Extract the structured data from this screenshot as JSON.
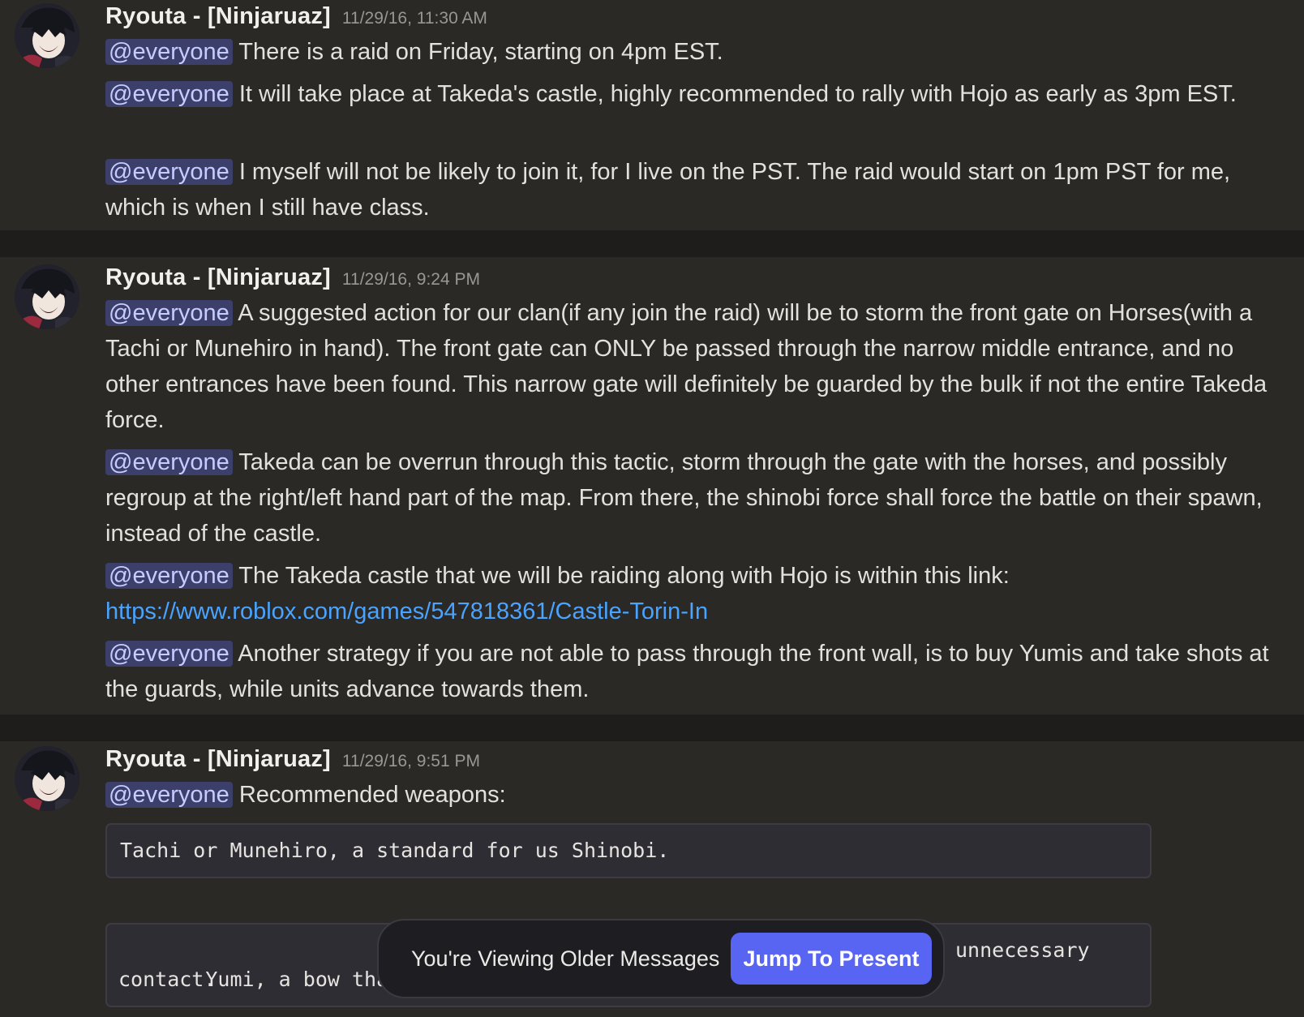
{
  "messages": [
    {
      "author": "Ryouta - [Ninjaruaz]",
      "timestamp": "11/29/16, 11:30 AM",
      "paragraphs": [
        {
          "mention": "@everyone",
          "text": "There is a raid on Friday, starting on 4pm EST."
        },
        {
          "mention": "@everyone",
          "text": "It will take place at Takeda's castle, highly recommended to rally with Hojo as early as 3pm EST."
        },
        {
          "mention": "@everyone",
          "text": "I myself will not be likely to join it, for I live on the PST. The raid would start on 1pm PST for me, which is when I still have class."
        }
      ]
    },
    {
      "author": "Ryouta - [Ninjaruaz]",
      "timestamp": "11/29/16, 9:24 PM",
      "paragraphs": [
        {
          "mention": "@everyone",
          "text": "A suggested action for our clan(if any join the raid) will be to storm the front gate on Horses(with a Tachi or Munehiro in hand). The front gate can ONLY be passed through the narrow middle entrance, and no other entrances have been found. This narrow gate will definitely be guarded by the bulk if not the entire Takeda force."
        },
        {
          "mention": "@everyone",
          "text": "Takeda can be overrun through this tactic, storm through the gate with the horses, and possibly regroup at the right/left hand part of the map. From there, the shinobi force shall force the battle on their spawn, instead of the castle."
        },
        {
          "mention": "@everyone",
          "text": "The Takeda castle that we will be raiding along with Hojo is within this link:",
          "link": "https://www.roblox.com/games/547818361/Castle-Torin-In"
        },
        {
          "mention": "@everyone",
          "text": "Another strategy if you are not able to pass through the front wall, is to buy Yumis and take shots at the guards, while units advance towards them."
        }
      ]
    },
    {
      "author": "Ryouta - [Ninjaruaz]",
      "timestamp": "11/29/16, 9:51 PM",
      "paragraphs": [
        {
          "mention": "@everyone",
          "text": "Recommended weapons:"
        }
      ],
      "code_blocks": [
        "Tachi or Munehiro, a standard for us Shinobi.",
        " Yumi, a bow that a",
        "unnecessary\ncontact."
      ]
    }
  ],
  "toast": {
    "text": "You're Viewing Older Messages",
    "button_label": "Jump To Present"
  },
  "colors": {
    "background": "#2b2926",
    "mention_bg": "#3b3f6a",
    "link": "#4aa3ff",
    "button": "#5865f2"
  },
  "icons": {
    "avatar": "anime-character-avatar"
  }
}
